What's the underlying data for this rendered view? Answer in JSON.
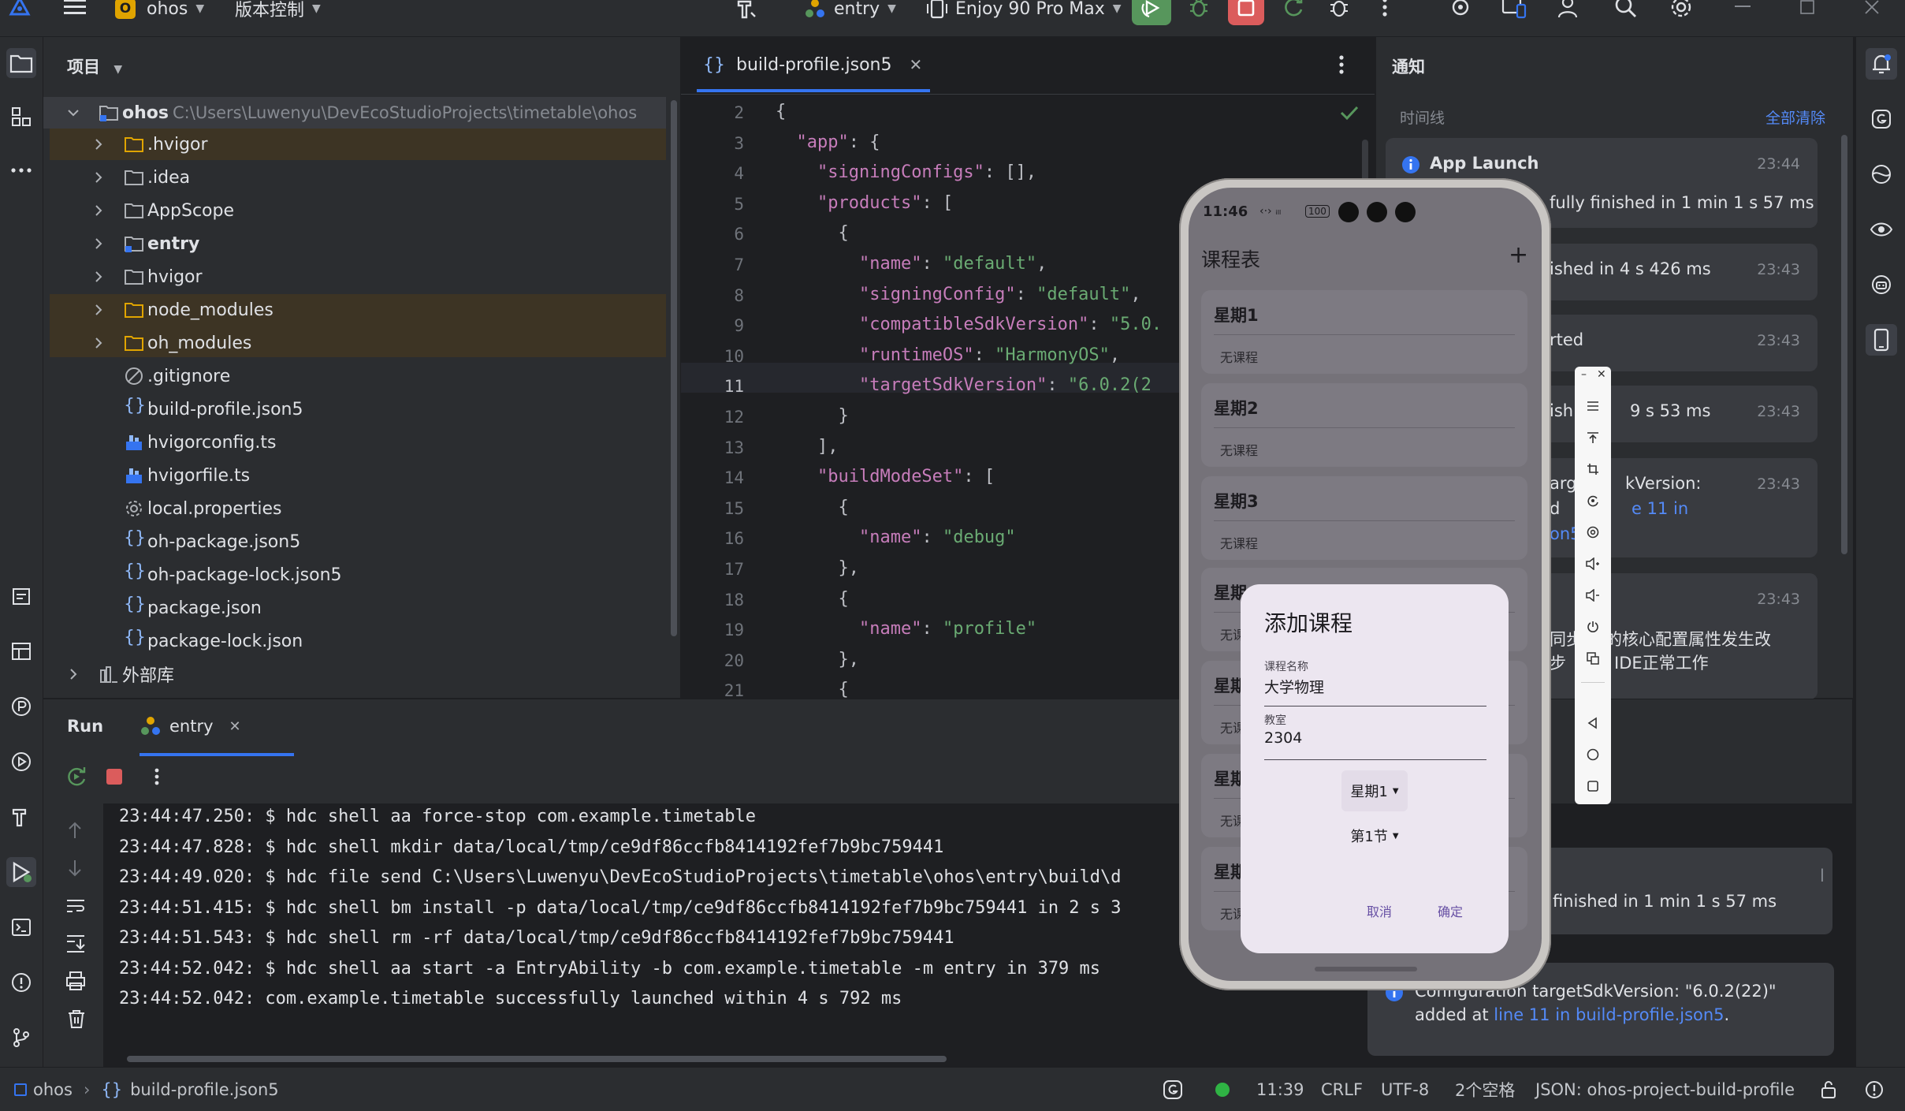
{
  "titlebar": {
    "project_badge": "O",
    "project_name": "ohos",
    "vcs": "版本控制",
    "run_config": "entry",
    "device": "Enjoy 90 Pro Max"
  },
  "project_panel": {
    "title": "项目",
    "root_name": "ohos",
    "root_path": "C:\\Users\\Luwenyu\\DevEcoStudioProjects\\timetable\\ohos",
    "items": [
      {
        "label": "hvigor-dot",
        "text": ".hvigor"
      },
      {
        "label": "idea",
        "text": ".idea"
      },
      {
        "label": "appscope",
        "text": "AppScope"
      },
      {
        "label": "entry",
        "text": "entry"
      },
      {
        "label": "hvigor",
        "text": "hvigor"
      },
      {
        "label": "node-modules",
        "text": "node_modules"
      },
      {
        "label": "oh-modules",
        "text": "oh_modules"
      },
      {
        "label": "gitignore",
        "text": ".gitignore"
      },
      {
        "label": "build-profile",
        "text": "build-profile.json5"
      },
      {
        "label": "hvigorconfig",
        "text": "hvigorconfig.ts"
      },
      {
        "label": "hvigorfile",
        "text": "hvigorfile.ts"
      },
      {
        "label": "local-properties",
        "text": "local.properties"
      },
      {
        "label": "oh-package",
        "text": "oh-package.json5"
      },
      {
        "label": "oh-package-lock",
        "text": "oh-package-lock.json5"
      },
      {
        "label": "package",
        "text": "package.json"
      },
      {
        "label": "package-lock",
        "text": "package-lock.json"
      }
    ],
    "external_libs": "外部库"
  },
  "editor": {
    "tab": "build-profile.json5",
    "line_numbers": [
      "2",
      "3",
      "4",
      "5",
      "6",
      "7",
      "8",
      "9",
      "10",
      "11",
      "12",
      "13",
      "14",
      "15",
      "16",
      "17",
      "18",
      "19",
      "20",
      "21"
    ],
    "lines": [
      [
        "{"
      ],
      [
        "  ",
        "\"app\"",
        ": {"
      ],
      [
        "    ",
        "\"signingConfigs\"",
        ": [],"
      ],
      [
        "    ",
        "\"products\"",
        ": ["
      ],
      [
        "      {"
      ],
      [
        "        ",
        "\"name\"",
        ": ",
        "\"default\"",
        ","
      ],
      [
        "        ",
        "\"signingConfig\"",
        ": ",
        "\"default\"",
        ","
      ],
      [
        "        ",
        "\"compatibleSdkVersion\"",
        ": ",
        "\"5.0.",
        ""
      ],
      [
        "        ",
        "\"runtimeOS\"",
        ": ",
        "\"HarmonyOS\"",
        ","
      ],
      [
        "        ",
        "\"targetSdkVersion\"",
        ": ",
        "\"6.0.2(2",
        ""
      ],
      [
        "      }"
      ],
      [
        "    ],"
      ],
      [
        "    ",
        "\"buildModeSet\"",
        ": ["
      ],
      [
        "      {"
      ],
      [
        "        ",
        "\"name\"",
        ": ",
        "\"debug\"",
        ""
      ],
      [
        "      },"
      ],
      [
        "      {"
      ],
      [
        "        ",
        "\"name\"",
        ": ",
        "\"profile\"",
        ""
      ],
      [
        "      },"
      ],
      [
        "      {"
      ]
    ]
  },
  "notifications": {
    "title": "通知",
    "timeline": "时间线",
    "clear_all": "全部清除",
    "cards": [
      {
        "title": "App Launch",
        "time": "23:44",
        "text": "fully finished in 1 min 1 s 57 ms"
      },
      {
        "time": "23:43",
        "text": "ished in 4 s 426 ms"
      },
      {
        "time": "23:43",
        "text": "rted"
      },
      {
        "time": "23:43",
        "text": "ish",
        "text2": "9 s 53 ms"
      },
      {
        "time": "23:43",
        "line1": "arg",
        "line1b": "kVersion:",
        "line2": "d",
        "line2b": "e 11 in",
        "line3": "on5"
      },
      {
        "time": "23:43",
        "line1": "同步",
        "line1b": "程的核心配置属性发生改",
        "line2": "步",
        "line2b": "IDE正常工作"
      }
    ],
    "popup1": {
      "text": "ly finished in 1 min 1 s 57 ms",
      "trail": "l"
    },
    "popup2": {
      "text1": "Configuration targetSdkVersion: \"6.0.2(22)\"",
      "text2": "added at ",
      "link": "line 11 in build-profile.json5",
      "tail": "."
    }
  },
  "run_panel": {
    "title": "Run",
    "tab": "entry",
    "lines": [
      "23:44:47.250: $ hdc shell aa force-stop com.example.timetable",
      "23:44:47.828: $ hdc shell mkdir data/local/tmp/ce9df86ccfb8414192fef7b9bc759441",
      "23:44:49.020: $ hdc file send C:\\Users\\Luwenyu\\DevEcoStudioProjects\\timetable\\ohos\\entry\\build\\d",
      "23:44:51.415: $ hdc shell bm install -p data/local/tmp/ce9df86ccfb8414192fef7b9bc759441 in 2 s 3",
      "23:44:51.543: $ hdc shell rm -rf data/local/tmp/ce9df86ccfb8414192fef7b9bc759441",
      "23:44:52.042: $ hdc shell aa start -a EntryAbility -b com.example.timetable -m entry in 379 ms",
      "23:44:52.042: com.example.timetable successfully launched within 4 s 792 ms"
    ]
  },
  "statusbar": {
    "project": "ohos",
    "file": "build-profile.json5",
    "position": "11:39",
    "line_sep": "CRLF",
    "encoding": "UTF-8",
    "indent": "2个空格",
    "schema": "JSON: ohos-project-build-profile"
  },
  "phone": {
    "time": "11:46",
    "battery": "100",
    "app_title": "课程表",
    "days": [
      {
        "name": "星期1",
        "none": "无课程"
      },
      {
        "name": "星期2",
        "none": "无课程"
      },
      {
        "name": "星期3",
        "none": "无课程"
      },
      {
        "name": "星期4",
        "none": "无课程"
      },
      {
        "name": "星期5",
        "none": "无课程"
      },
      {
        "name": "星期6",
        "none": "无课程"
      },
      {
        "name": "星期7",
        "none": "无课程"
      }
    ],
    "dialog": {
      "title": "添加课程",
      "course_label": "课程名称",
      "course_value": "大学物理",
      "room_label": "教室",
      "room_value": "2304",
      "day_select": "星期1",
      "period_select": "第1节",
      "cancel": "取消",
      "confirm": "确定"
    }
  },
  "colors": {
    "accent": "#3574f0",
    "run_green": "#57965c",
    "stop_red": "#db5c5c"
  }
}
